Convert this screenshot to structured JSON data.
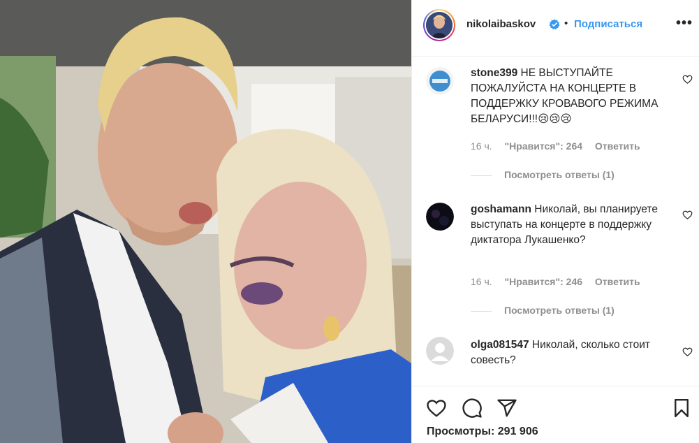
{
  "post": {
    "username": "nikolaibaskov",
    "follow_label": "Подписаться",
    "dot": "•",
    "more_label": "•••",
    "views_label": "Просмотры: 291 906"
  },
  "comments": [
    {
      "username": "stone399",
      "text": "НЕ ВЫСТУПАЙТЕ ПОЖАЛУЙСТА НА КОНЦЕРТЕ В ПОДДЕРЖКУ КРОВАВОГО РЕЖИМА БЕЛАРУСИ!!!😢😢😢",
      "time": "16 ч.",
      "likes": "\"Нравится\": 264",
      "reply": "Ответить",
      "view_replies": "Посмотреть ответы (1)"
    },
    {
      "username": "goshamann",
      "text": "Николай, вы планируете выступать на концерте в поддержку диктатора Лукашенко?",
      "time": "16 ч.",
      "likes": "\"Нравится\": 246",
      "reply": "Ответить",
      "view_replies": "Посмотреть ответы (1)"
    },
    {
      "username": "olga081547",
      "text": "Николай, сколько стоит совесть?"
    }
  ],
  "icons": [
    "verified-badge-icon",
    "heart-icon",
    "comment-icon",
    "share-icon",
    "bookmark-icon",
    "more-icon"
  ],
  "colors": {
    "link": "#3897f0",
    "text": "#262626",
    "meta": "#8e8e8e",
    "border": "#efefef"
  }
}
